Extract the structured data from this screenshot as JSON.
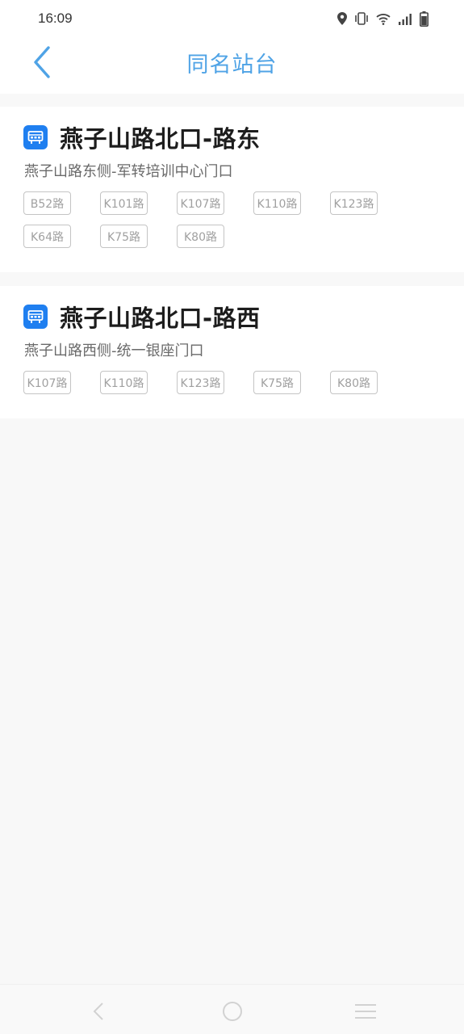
{
  "status_bar": {
    "time": "16:09",
    "icons": [
      "location-icon",
      "vibrate-icon",
      "wifi-icon",
      "signal-icon",
      "battery-icon"
    ]
  },
  "header": {
    "title": "同名站台",
    "back_icon": "chevron-left-icon"
  },
  "stations": [
    {
      "name": "燕子山路北口-路东",
      "description": "燕子山路东侧-军转培训中心门口",
      "routes": [
        "B52路",
        "K101路",
        "K107路",
        "K110路",
        "K123路",
        "K64路",
        "K75路",
        "K80路"
      ]
    },
    {
      "name": "燕子山路北口-路西",
      "description": "燕子山路西侧-统一银座门口",
      "routes": [
        "K107路",
        "K110路",
        "K123路",
        "K75路",
        "K80路"
      ]
    }
  ],
  "bottom_nav": {
    "keys": [
      "back-key",
      "home-key",
      "menu-key"
    ]
  },
  "colors": {
    "accent": "#4fa3e6",
    "bus_icon": "#1f7ff0"
  }
}
